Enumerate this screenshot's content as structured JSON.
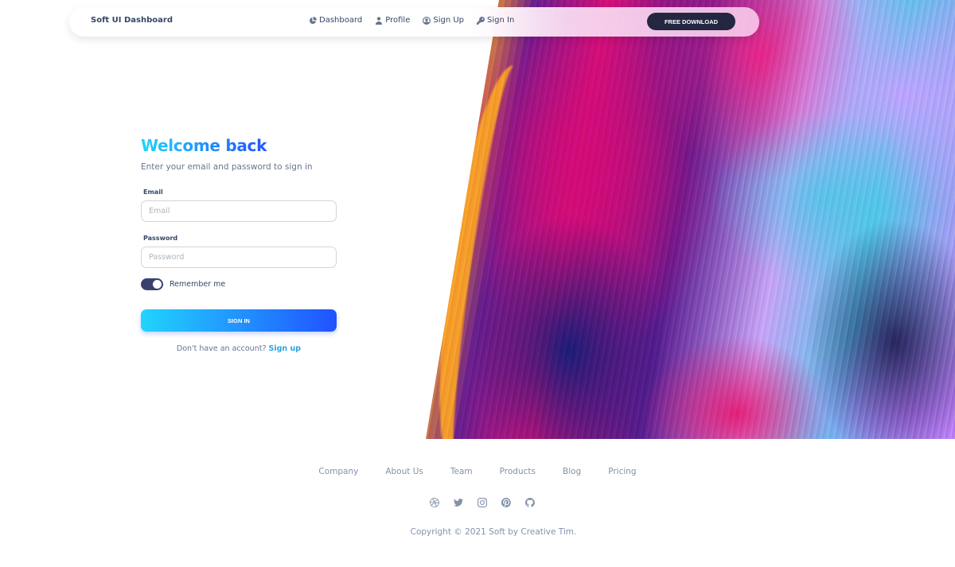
{
  "navbar": {
    "brand": "Soft UI Dashboard",
    "links": [
      {
        "label": "Dashboard",
        "icon": "chart-pie-icon"
      },
      {
        "label": "Profile",
        "icon": "user-icon"
      },
      {
        "label": "Sign Up",
        "icon": "user-circle-icon"
      },
      {
        "label": "Sign In",
        "icon": "key-icon"
      }
    ],
    "download_label": "FREE DOWNLOAD"
  },
  "login": {
    "title": "Welcome back",
    "subtitle": "Enter your email and password to sign in",
    "email": {
      "label": "Email",
      "placeholder": "Email",
      "value": ""
    },
    "password": {
      "label": "Password",
      "placeholder": "Password",
      "value": ""
    },
    "remember": {
      "label": "Remember me",
      "checked": true
    },
    "submit_label": "SIGN IN",
    "signup_prompt": "Don't have an account?",
    "signup_link": "Sign up"
  },
  "colors": {
    "primary_gradient_start": "#21d4fd",
    "primary_gradient_end": "#2152ff",
    "dark": "#232742",
    "toggle": "#3a416f",
    "text_muted": "#8392ab"
  },
  "footer": {
    "links": [
      "Company",
      "About Us",
      "Team",
      "Products",
      "Blog",
      "Pricing"
    ],
    "socials": [
      "dribbble-icon",
      "twitter-icon",
      "instagram-icon",
      "pinterest-icon",
      "github-icon"
    ],
    "copyright": "Copyright © 2021 Soft by Creative Tim."
  }
}
